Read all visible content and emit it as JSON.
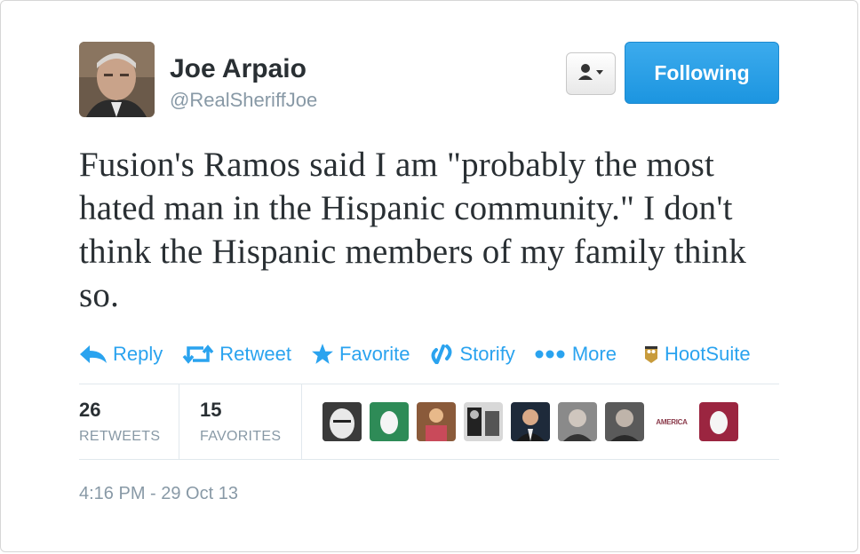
{
  "user": {
    "name": "Joe Arpaio",
    "handle": "@RealSheriffJoe",
    "follow_label": "Following"
  },
  "tweet": {
    "text": "Fusion's Ramos said I am \"probably the most hated man in the Hispanic community.\" I don't think the Hispanic members of my family think so.",
    "timestamp": "4:16 PM - 29 Oct 13"
  },
  "actions": [
    {
      "label": "Reply",
      "icon": "reply-icon"
    },
    {
      "label": "Retweet",
      "icon": "retweet-icon"
    },
    {
      "label": "Favorite",
      "icon": "star-icon"
    },
    {
      "label": "Storify",
      "icon": "storify-icon"
    },
    {
      "label": "More",
      "icon": "more-dots-icon"
    },
    {
      "label": "HootSuite",
      "icon": "hootsuite-icon"
    }
  ],
  "stats": {
    "retweets": {
      "count": "26",
      "label": "RETWEETS"
    },
    "favorites": {
      "count": "15",
      "label": "FAVORITES"
    }
  },
  "favoriter_avatars": [
    {
      "label": ""
    },
    {
      "label": ""
    },
    {
      "label": ""
    },
    {
      "label": ""
    },
    {
      "label": ""
    },
    {
      "label": ""
    },
    {
      "label": ""
    },
    {
      "label": "AMERICA"
    },
    {
      "label": ""
    }
  ],
  "colors": {
    "link_blue": "#2aa3ef",
    "follow_button": "#1c95e0",
    "text": "#292f33",
    "muted": "#8899a6"
  }
}
